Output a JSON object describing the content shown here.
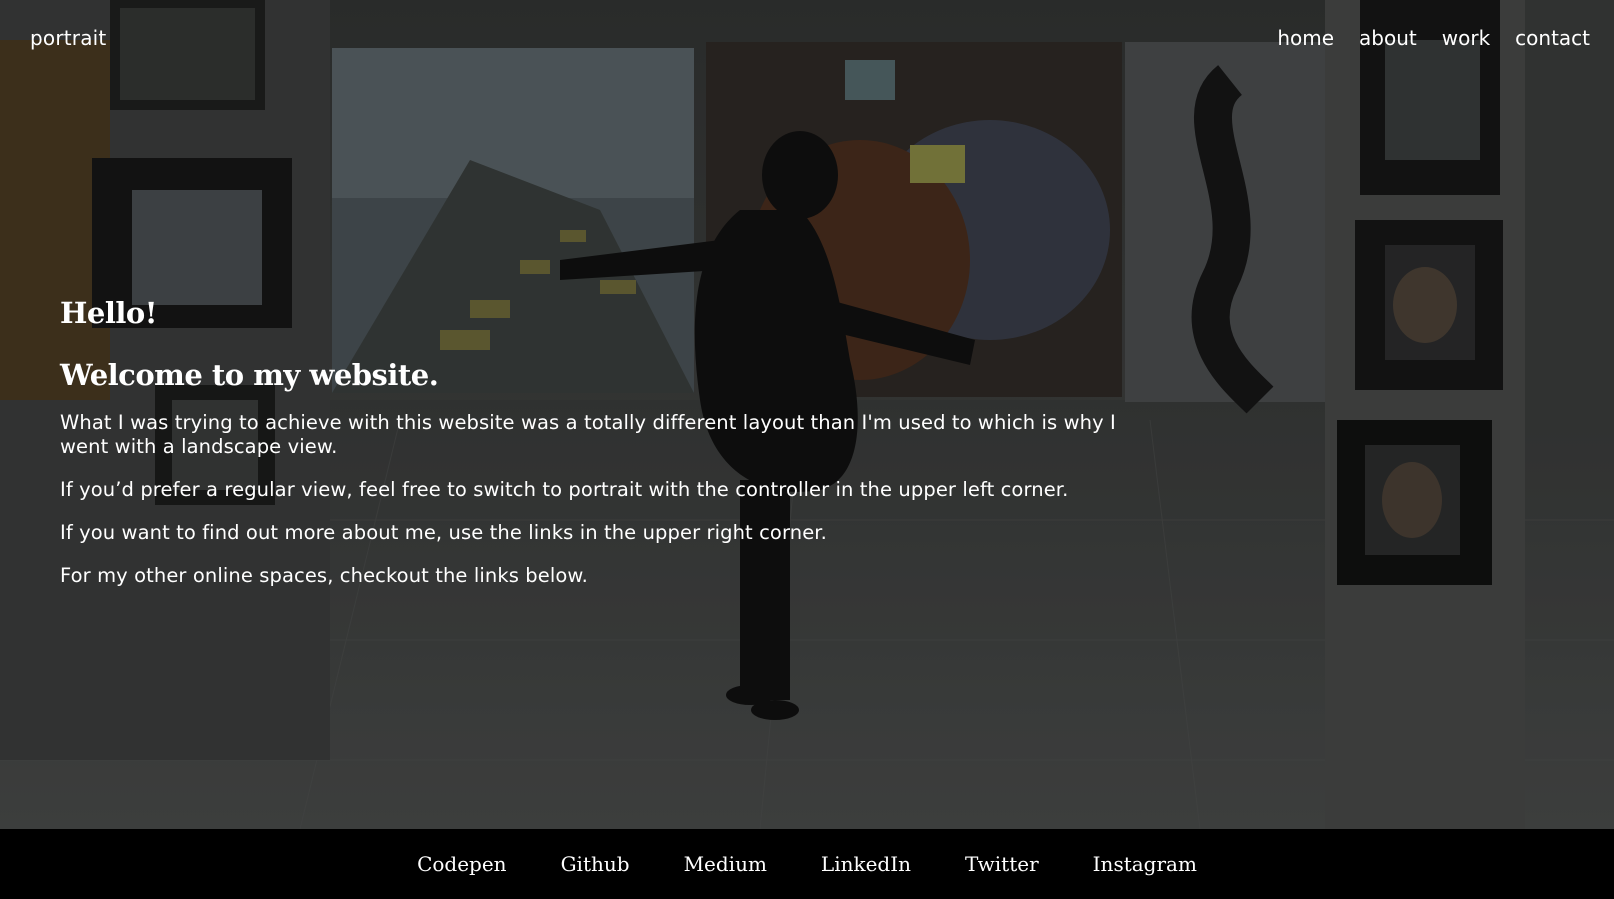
{
  "header": {
    "toggle_label": "portrait",
    "nav": [
      {
        "label": "home"
      },
      {
        "label": "about"
      },
      {
        "label": "work"
      },
      {
        "label": "contact"
      }
    ]
  },
  "intro": {
    "greeting": "Hello!",
    "welcome": "Welcome to my website.",
    "paragraphs": [
      "What I was trying to achieve with this website was a totally different layout than I'm used to which is why I went with a landscape view.",
      "If you’d prefer a regular view, feel free to switch to portrait with the controller in the upper left corner.",
      "If you want to find out more about me, use the links in the upper right corner.",
      "For my other online spaces, checkout the links below."
    ]
  },
  "footer": {
    "links": [
      {
        "label": "Codepen"
      },
      {
        "label": "Github"
      },
      {
        "label": "Medium"
      },
      {
        "label": "LinkedIn"
      },
      {
        "label": "Twitter"
      },
      {
        "label": "Instagram"
      }
    ]
  },
  "colors": {
    "text": "#ffffff",
    "footer_bg": "#000000",
    "photo_tint": "#2b2d2c"
  }
}
